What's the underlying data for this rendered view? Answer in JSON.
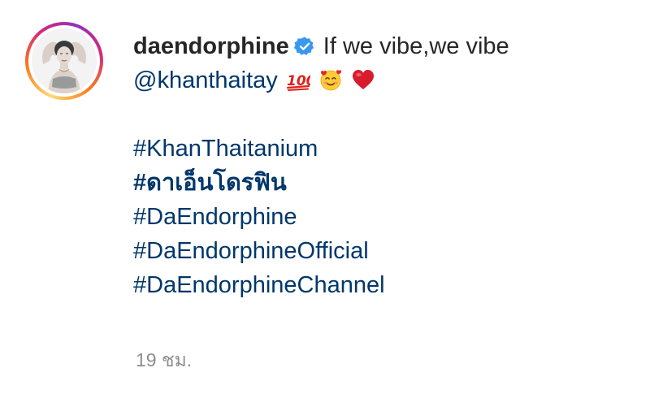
{
  "post": {
    "username": "daendorphine",
    "verified_icon": "verified-badge-icon",
    "caption_text": "If we vibe,we vibe",
    "mention": "@khanthaitay",
    "emojis": [
      "hundred-points-emoji",
      "smiling-face-with-hearts-emoji",
      "red-heart-emoji"
    ],
    "hashtags": [
      {
        "text": "#KhanThaitanium",
        "bold": false
      },
      {
        "text": "#ดาเอ็นโดรฟิน",
        "bold": true
      },
      {
        "text": "#DaEndorphine",
        "bold": false
      },
      {
        "text": "#DaEndorphineOfficial",
        "bold": false
      },
      {
        "text": "#DaEndorphineChannel",
        "bold": false
      }
    ],
    "timestamp": "19 ชม."
  },
  "colors": {
    "text": "#262626",
    "link": "#00376b",
    "verified": "#3897f0",
    "muted": "#8e8e8e"
  }
}
